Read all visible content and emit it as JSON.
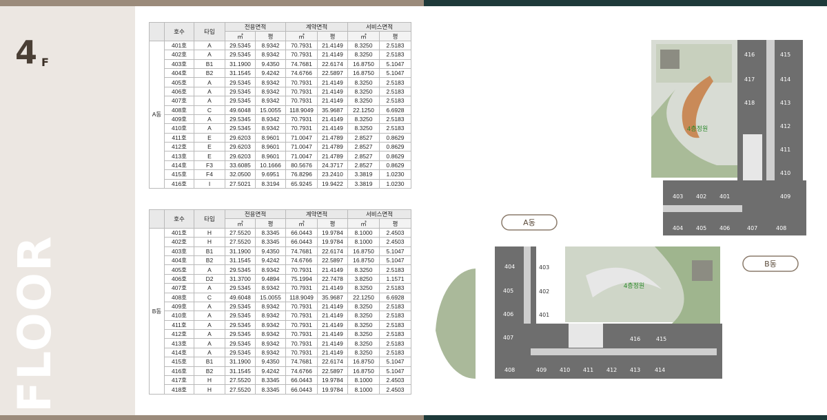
{
  "floor": {
    "number": "4",
    "suffix": "F",
    "side_word": "FLOOR"
  },
  "table_headers": {
    "unit": "호수",
    "type": "타입",
    "exclusive": "전용면적",
    "contract": "계약면적",
    "service": "서비스면적",
    "sqm": "㎡",
    "pyeong": "평"
  },
  "building_a": {
    "name": "A동",
    "rows": [
      [
        "401호",
        "A",
        "29.5345",
        "8.9342",
        "70.7931",
        "21.4149",
        "8.3250",
        "2.5183"
      ],
      [
        "402호",
        "A",
        "29.5345",
        "8.9342",
        "70.7931",
        "21.4149",
        "8.3250",
        "2.5183"
      ],
      [
        "403호",
        "B1",
        "31.1900",
        "9.4350",
        "74.7681",
        "22.6174",
        "16.8750",
        "5.1047"
      ],
      [
        "404호",
        "B2",
        "31.1545",
        "9.4242",
        "74.6766",
        "22.5897",
        "16.8750",
        "5.1047"
      ],
      [
        "405호",
        "A",
        "29.5345",
        "8.9342",
        "70.7931",
        "21.4149",
        "8.3250",
        "2.5183"
      ],
      [
        "406호",
        "A",
        "29.5345",
        "8.9342",
        "70.7931",
        "21.4149",
        "8.3250",
        "2.5183"
      ],
      [
        "407호",
        "A",
        "29.5345",
        "8.9342",
        "70.7931",
        "21.4149",
        "8.3250",
        "2.5183"
      ],
      [
        "408호",
        "C",
        "49.6048",
        "15.0055",
        "118.9049",
        "35.9687",
        "22.1250",
        "6.6928"
      ],
      [
        "409호",
        "A",
        "29.5345",
        "8.9342",
        "70.7931",
        "21.4149",
        "8.3250",
        "2.5183"
      ],
      [
        "410호",
        "A",
        "29.5345",
        "8.9342",
        "70.7931",
        "21.4149",
        "8.3250",
        "2.5183"
      ],
      [
        "411호",
        "E",
        "29.6203",
        "8.9601",
        "71.0047",
        "21.4789",
        "2.8527",
        "0.8629"
      ],
      [
        "412호",
        "E",
        "29.6203",
        "8.9601",
        "71.0047",
        "21.4789",
        "2.8527",
        "0.8629"
      ],
      [
        "413호",
        "E",
        "29.6203",
        "8.9601",
        "71.0047",
        "21.4789",
        "2.8527",
        "0.8629"
      ],
      [
        "414호",
        "F3",
        "33.6085",
        "10.1666",
        "80.5676",
        "24.3717",
        "2.8527",
        "0.8629"
      ],
      [
        "415호",
        "F4",
        "32.0500",
        "9.6951",
        "76.8296",
        "23.2410",
        "3.3819",
        "1.0230"
      ],
      [
        "416호",
        "I",
        "27.5021",
        "8.3194",
        "65.9245",
        "19.9422",
        "3.3819",
        "1.0230"
      ]
    ]
  },
  "building_b": {
    "name": "B동",
    "rows": [
      [
        "401호",
        "H",
        "27.5520",
        "8.3345",
        "66.0443",
        "19.9784",
        "8.1000",
        "2.4503"
      ],
      [
        "402호",
        "H",
        "27.5520",
        "8.3345",
        "66.0443",
        "19.9784",
        "8.1000",
        "2.4503"
      ],
      [
        "403호",
        "B1",
        "31.1900",
        "9.4350",
        "74.7681",
        "22.6174",
        "16.8750",
        "5.1047"
      ],
      [
        "404호",
        "B2",
        "31.1545",
        "9.4242",
        "74.6766",
        "22.5897",
        "16.8750",
        "5.1047"
      ],
      [
        "405호",
        "A",
        "29.5345",
        "8.9342",
        "70.7931",
        "21.4149",
        "8.3250",
        "2.5183"
      ],
      [
        "406호",
        "D2",
        "31.3700",
        "9.4894",
        "75.1994",
        "22.7478",
        "3.8250",
        "1.1571"
      ],
      [
        "407호",
        "A",
        "29.5345",
        "8.9342",
        "70.7931",
        "21.4149",
        "8.3250",
        "2.5183"
      ],
      [
        "408호",
        "C",
        "49.6048",
        "15.0055",
        "118.9049",
        "35.9687",
        "22.1250",
        "6.6928"
      ],
      [
        "409호",
        "A",
        "29.5345",
        "8.9342",
        "70.7931",
        "21.4149",
        "8.3250",
        "2.5183"
      ],
      [
        "410호",
        "A",
        "29.5345",
        "8.9342",
        "70.7931",
        "21.4149",
        "8.3250",
        "2.5183"
      ],
      [
        "411호",
        "A",
        "29.5345",
        "8.9342",
        "70.7931",
        "21.4149",
        "8.3250",
        "2.5183"
      ],
      [
        "412호",
        "A",
        "29.5345",
        "8.9342",
        "70.7931",
        "21.4149",
        "8.3250",
        "2.5183"
      ],
      [
        "413호",
        "A",
        "29.5345",
        "8.9342",
        "70.7931",
        "21.4149",
        "8.3250",
        "2.5183"
      ],
      [
        "414호",
        "A",
        "29.5345",
        "8.9342",
        "70.7931",
        "21.4149",
        "8.3250",
        "2.5183"
      ],
      [
        "415호",
        "B1",
        "31.1900",
        "9.4350",
        "74.7681",
        "22.6174",
        "16.8750",
        "5.1047"
      ],
      [
        "416호",
        "B2",
        "31.1545",
        "9.4242",
        "74.6766",
        "22.5897",
        "16.8750",
        "5.1047"
      ],
      [
        "417호",
        "H",
        "27.5520",
        "8.3345",
        "66.0443",
        "19.9784",
        "8.1000",
        "2.4503"
      ],
      [
        "418호",
        "H",
        "27.5520",
        "8.3345",
        "66.0443",
        "19.9784",
        "8.1000",
        "2.4503"
      ]
    ]
  },
  "plan": {
    "label_a": "A동",
    "label_b": "B동",
    "garden_label": "4층정원",
    "a_units": [
      "404",
      "403",
      "405",
      "402",
      "406",
      "401",
      "407",
      "408",
      "409",
      "410",
      "411",
      "412",
      "413",
      "414",
      "416",
      "415"
    ],
    "b_units": [
      "416",
      "415",
      "417",
      "414",
      "418",
      "413",
      "412",
      "411",
      "410",
      "403",
      "402",
      "401",
      "409",
      "404",
      "405",
      "406",
      "407",
      "408"
    ]
  }
}
